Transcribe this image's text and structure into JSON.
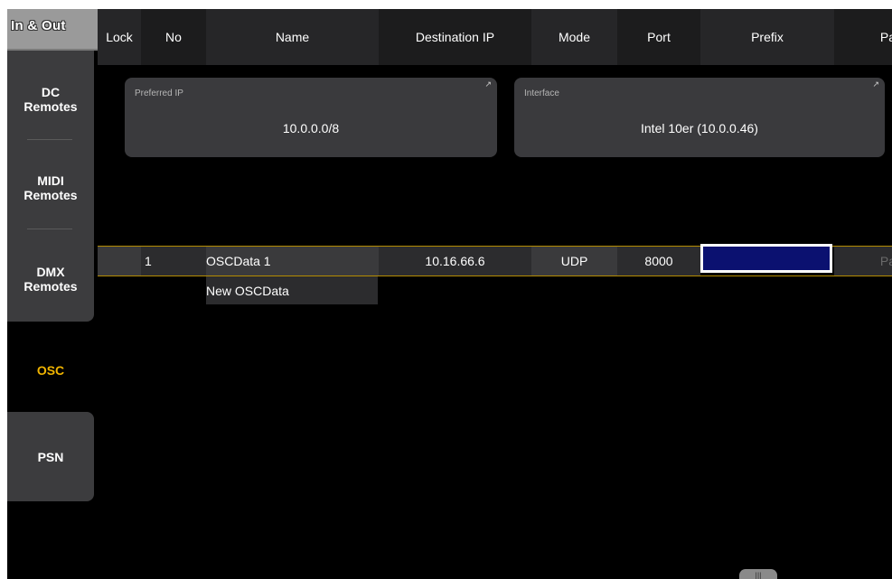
{
  "window": {
    "title": "In & Out"
  },
  "sidebar": {
    "items": [
      {
        "label_line1": "DC",
        "label_line2": "Remotes"
      },
      {
        "label_line1": "MIDI",
        "label_line2": "Remotes"
      },
      {
        "label_line1": "DMX",
        "label_line2": "Remotes"
      },
      {
        "label_line1": "OSC",
        "label_line2": ""
      },
      {
        "label_line1": "PSN",
        "label_line2": ""
      }
    ],
    "active": "OSC"
  },
  "fields": {
    "preferred_ip": {
      "label": "Preferred IP",
      "value": "10.0.0.0/8"
    },
    "interface": {
      "label": "Interface",
      "value": "Intel 10er (10.0.0.46)"
    }
  },
  "table": {
    "columns": [
      "Lock",
      "No",
      "Name",
      "Destination IP",
      "Mode",
      "Port",
      "Prefix",
      "Pa"
    ],
    "rows": [
      {
        "lock": "",
        "no": "1",
        "name": "OSCData 1",
        "destination_ip": "10.16.66.6",
        "mode": "UDP",
        "port": "8000",
        "prefix": "",
        "pa": "Pa"
      }
    ],
    "new_row_label": "New OSCData"
  },
  "colors": {
    "accent": "#f0b400",
    "selected_cell": "#0b1170",
    "panel": "#3a3a3d",
    "background": "#000000"
  },
  "icons": {
    "field_edit": "corner-arrow-icon",
    "scroll": "scroll-handle-icon"
  }
}
